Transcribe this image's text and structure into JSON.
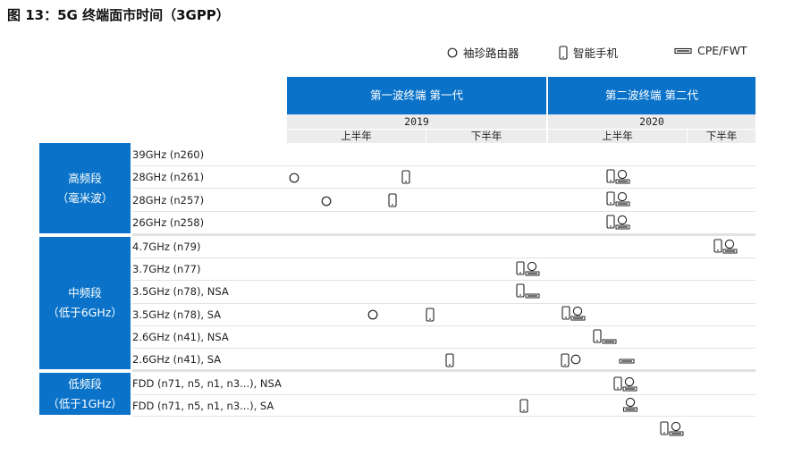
{
  "title": "图 13：5G 终端面市时间（3GPP）",
  "legend": [
    {
      "label": "袖珍路由器",
      "icon": "circle-router-icon"
    },
    {
      "label": "智能手机",
      "icon": "phone-icon"
    },
    {
      "label": "CPE/FWT",
      "icon": "cpe-icon"
    }
  ],
  "waves": [
    {
      "label": "第一波终端   第一代"
    },
    {
      "label": "第二波终端   第二代"
    }
  ],
  "years": [
    "2019",
    "2020"
  ],
  "halves": [
    "上半年",
    "下半年",
    "上半年",
    "下半年"
  ],
  "groups": [
    {
      "line1": "高频段",
      "line2": "（毫米波）"
    },
    {
      "line1": "中频段",
      "line2": "（低于6GHz）"
    },
    {
      "line1": "低频段",
      "line2": "（低于1GHz）"
    }
  ],
  "rows": [
    "39GHz (n260)",
    "28GHz (n261)",
    "28GHz (n257)",
    "26GHz (n258)",
    "4.7GHz (n79)",
    "3.7GHz (n77)",
    "3.5GHz (n78), NSA",
    "3.5GHz (n78), SA",
    "2.6GHz (n41), NSA",
    "2.6GHz (n41), SA",
    "FDD (n71, n5, n1, n3...), NSA",
    "FDD (n71, n5, n1, n3...), SA"
  ],
  "colors": {
    "accent": "#0a73c9",
    "header_gray": "#ececec"
  }
}
